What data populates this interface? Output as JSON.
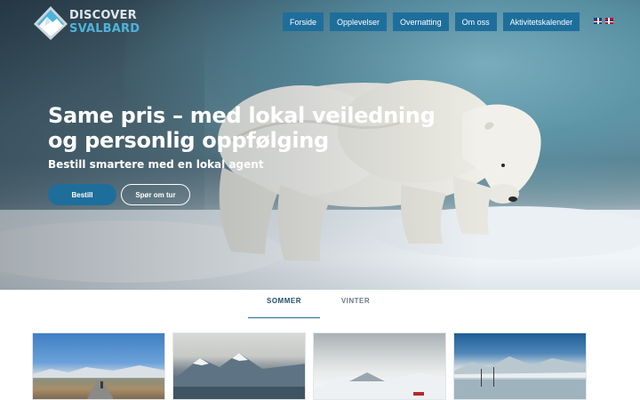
{
  "brand": {
    "line1": "DISCOVER",
    "line2": "SVALBARD"
  },
  "nav": {
    "items": [
      {
        "label": "Forside"
      },
      {
        "label": "Opplevelser"
      },
      {
        "label": "Overnatting"
      },
      {
        "label": "Om oss"
      },
      {
        "label": "Aktivitetskalender"
      }
    ],
    "languages": [
      "English",
      "Norsk"
    ]
  },
  "hero": {
    "headline": "Same pris – med lokal veiledning og personlig oppfølging",
    "subline": "Bestill smartere med en lokal agent",
    "primary_button": "Bestill",
    "secondary_button": "Spør om tur"
  },
  "season_tabs": {
    "items": [
      {
        "label": "SOMMER",
        "active": true
      },
      {
        "label": "VINTER",
        "active": false
      }
    ]
  },
  "colors": {
    "accent": "#1e6e9c",
    "logo_accent": "#4fb3d9",
    "tab_text": "#1e4f6e"
  }
}
